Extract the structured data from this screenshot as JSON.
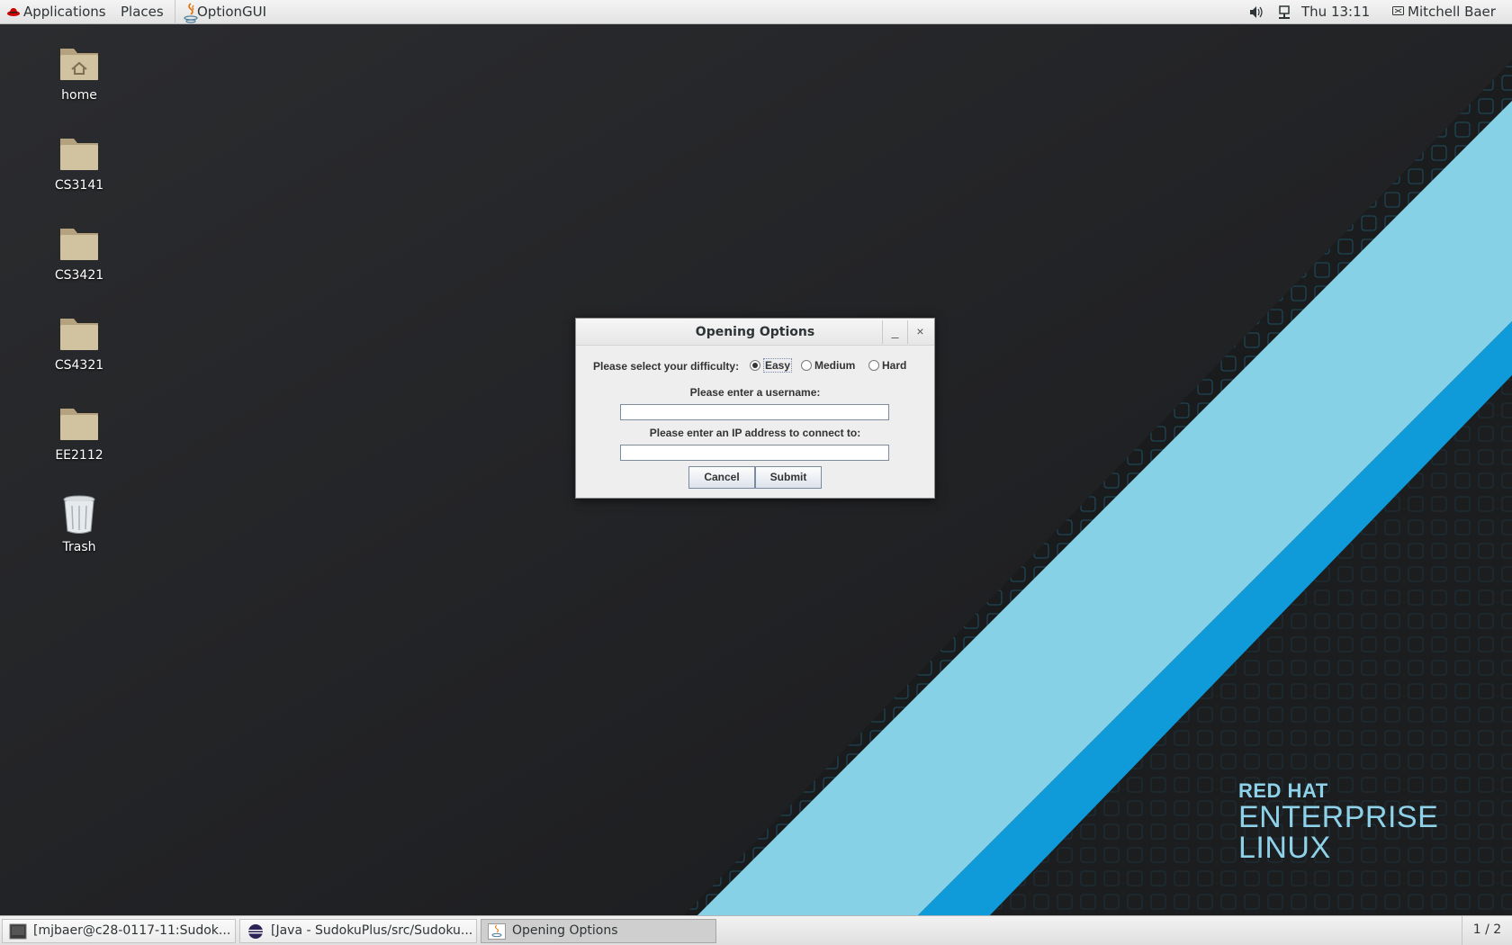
{
  "top_panel": {
    "applications": "Applications",
    "places": "Places",
    "active_app": "OptionGUI",
    "clock": "Thu 13:11",
    "user": "Mitchell Baer",
    "icons": [
      "redhat-icon",
      "java-icon",
      "volume-icon",
      "network-icon",
      "user-icon"
    ]
  },
  "desktop": {
    "icons": [
      {
        "label": "home",
        "icon": "home-folder-icon"
      },
      {
        "label": "CS3141",
        "icon": "folder-icon"
      },
      {
        "label": "CS3421",
        "icon": "folder-icon"
      },
      {
        "label": "CS4321",
        "icon": "folder-icon"
      },
      {
        "label": "EE2112",
        "icon": "folder-icon"
      },
      {
        "label": "Trash",
        "icon": "trash-icon"
      }
    ],
    "brand": {
      "line1": "RED HAT",
      "line2": "ENTERPRISE",
      "line3": "LINUX"
    },
    "colors": {
      "stripe_light": "#87d1e6",
      "stripe_dark": "#0f9ad9",
      "background": "#222325"
    }
  },
  "dialog": {
    "title": "Opening Options",
    "minimize": "_",
    "close": "×",
    "difficulty_label": "Please select your difficulty:",
    "difficulties": [
      "Easy",
      "Medium",
      "Hard"
    ],
    "selected_difficulty": "Easy",
    "username_label": "Please enter a username:",
    "username_value": "",
    "ip_label": "Please enter an IP address to connect to:",
    "ip_value": "",
    "cancel": "Cancel",
    "submit": "Submit"
  },
  "taskbar": {
    "tasks": [
      {
        "label": "[mjbaer@c28-0117-11:Sudok...",
        "icon": "terminal-icon"
      },
      {
        "label": "[Java - SudokuPlus/src/Sudoku...",
        "icon": "eclipse-icon"
      },
      {
        "label": "Opening Options",
        "icon": "java-icon",
        "active": true
      }
    ],
    "workspace": "1 / 2"
  }
}
